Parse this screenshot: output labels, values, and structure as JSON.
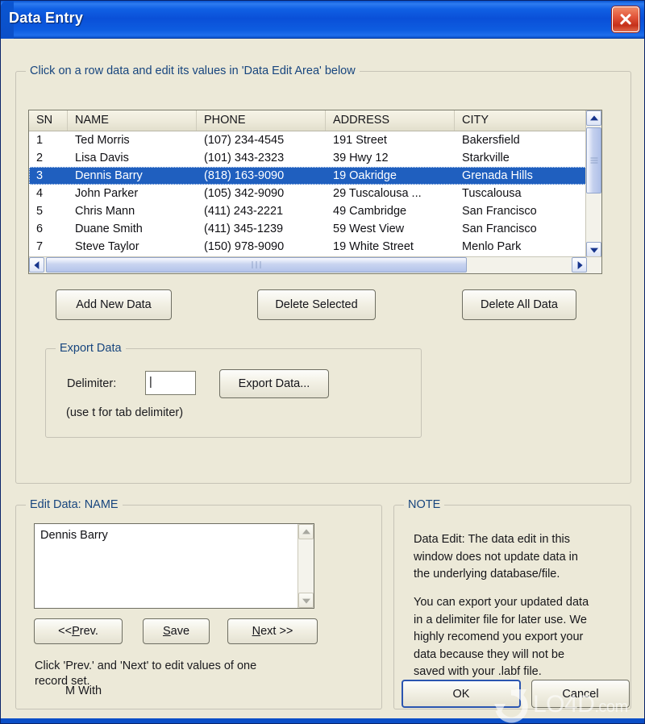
{
  "window": {
    "title": "Data Entry",
    "close_icon": "close-icon"
  },
  "main_group": {
    "legend": "Click on a row data and edit its values in 'Data Edit Area' below"
  },
  "table": {
    "columns": [
      "SN",
      "NAME",
      "PHONE",
      "ADDRESS",
      "CITY"
    ],
    "rows": [
      {
        "sn": "1",
        "name": "Ted Morris",
        "phone": "(107) 234-4545",
        "address": "191 Street",
        "city": "Bakersfield",
        "selected": false
      },
      {
        "sn": "2",
        "name": "Lisa Davis",
        "phone": "(101) 343-2323",
        "address": "39 Hwy 12",
        "city": "Starkville",
        "selected": false
      },
      {
        "sn": "3",
        "name": "Dennis Barry",
        "phone": "(818) 163-9090",
        "address": "19 Oakridge",
        "city": "Grenada Hills",
        "selected": true
      },
      {
        "sn": "4",
        "name": "John Parker",
        "phone": "(105) 342-9090",
        "address": "29 Tuscalousa ...",
        "city": " Tuscalousa",
        "selected": false
      },
      {
        "sn": "5",
        "name": "Chris Mann",
        "phone": "(411) 243-2221",
        "address": "49 Cambridge",
        "city": "San Francisco",
        "selected": false
      },
      {
        "sn": "6",
        "name": "Duane Smith",
        "phone": "(411) 345-1239",
        "address": "59 West View",
        "city": "San Francisco",
        "selected": false
      },
      {
        "sn": "7",
        "name": "Steve Taylor",
        "phone": "(150) 978-9090",
        "address": "19 White Street",
        "city": "Menlo Park",
        "selected": false
      }
    ],
    "vertical_scrollbar": {
      "up_icon": "chevron-up-icon",
      "down_icon": "chevron-down-icon"
    },
    "horizontal_scrollbar": {
      "left_icon": "chevron-left-icon",
      "right_icon": "chevron-right-icon"
    }
  },
  "actions": {
    "add_new_data": "Add New Data",
    "delete_selected": "Delete Selected",
    "delete_all_data": "Delete All Data"
  },
  "export": {
    "legend": "Export Data",
    "delimiter_label": "Delimiter:",
    "delimiter_value": "|",
    "export_button": "Export Data...",
    "hint": "(use t for tab delimiter)"
  },
  "edit": {
    "legend": "Edit Data: NAME",
    "value": "Dennis Barry",
    "prev_button": {
      "prefix": "<< ",
      "mnemonic": "P",
      "suffix": "rev."
    },
    "save_button": {
      "mnemonic": "S",
      "suffix": "ave"
    },
    "next_button": {
      "mnemonic": "N",
      "suffix": "ext >>"
    },
    "hint": "Click 'Prev.' and 'Next' to edit values of one\nrecord set.",
    "scrollbar": {
      "up_icon": "chevron-up-icon",
      "down_icon": "chevron-down-icon"
    }
  },
  "note": {
    "legend": "NOTE",
    "paragraph1": "Data Edit: The data edit in this\nwindow does not update data in\nthe underlying database/file.",
    "paragraph2": "You can export your updated data\nin a delimiter file for later use. We\nhighly recomend you export your\ndata because they will not be\nsaved with your .labf file."
  },
  "footer": {
    "status_text": "M With",
    "ok_button": "OK",
    "cancel_button": "Cancel"
  },
  "watermark": {
    "text": "LO4D",
    "suffix": ".com",
    "logo_icon": "refresh-circle-icon"
  },
  "colors": {
    "titlebar_blue": "#0B4FC8",
    "dialog_face": "#ECE9D8",
    "selection_blue": "#1F5FBF",
    "legend_text": "#17457E",
    "close_red": "#C5301A"
  }
}
